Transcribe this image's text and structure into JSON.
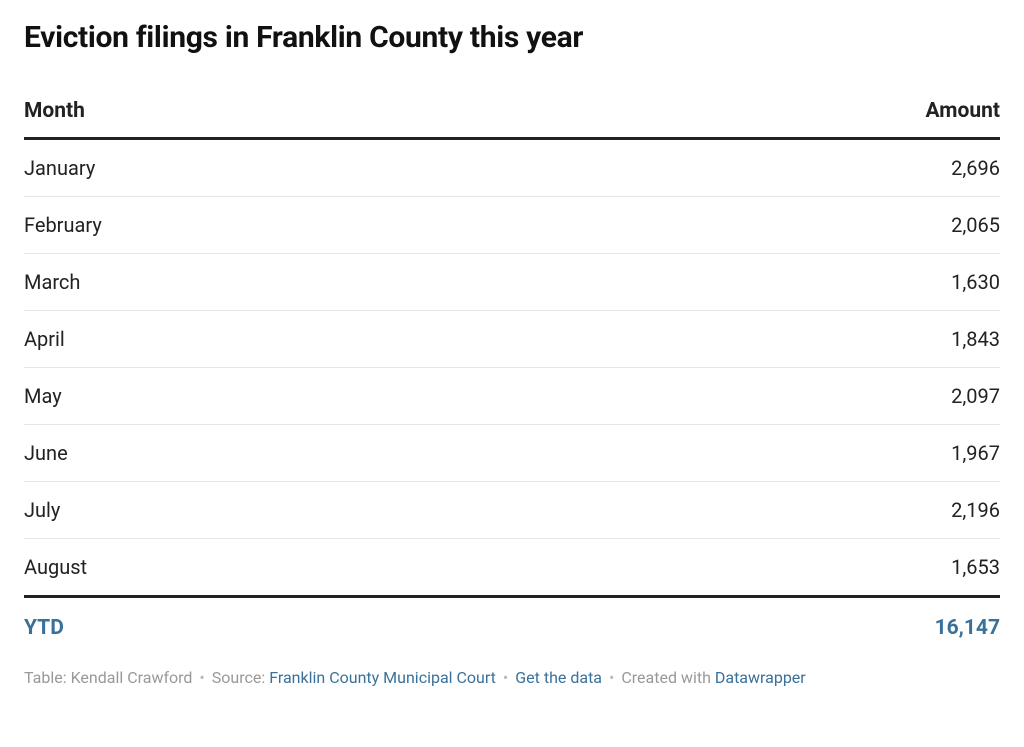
{
  "chart_data": {
    "type": "table",
    "title": "Eviction filings in Franklin County this year",
    "columns": [
      "Month",
      "Amount"
    ],
    "rows": [
      {
        "month": "January",
        "amount": "2,696"
      },
      {
        "month": "February",
        "amount": "2,065"
      },
      {
        "month": "March",
        "amount": "1,630"
      },
      {
        "month": "April",
        "amount": "1,843"
      },
      {
        "month": "May",
        "amount": "2,097"
      },
      {
        "month": "June",
        "amount": "1,967"
      },
      {
        "month": "July",
        "amount": "2,196"
      },
      {
        "month": "August",
        "amount": "1,653"
      }
    ],
    "total": {
      "label": "YTD",
      "amount": "16,147"
    }
  },
  "footer": {
    "table_prefix": "Table: ",
    "author": "Kendall Crawford",
    "source_prefix": "Source: ",
    "source_link": "Franklin County Municipal Court",
    "get_data": "Get the data",
    "created_prefix": "Created with ",
    "created_link": "Datawrapper"
  }
}
